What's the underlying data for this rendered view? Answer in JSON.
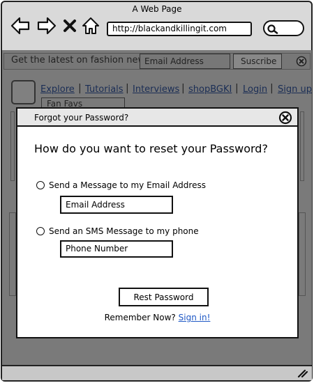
{
  "window": {
    "title": "A Web Page",
    "url": "http://blackandkillingit.com"
  },
  "newsbar": {
    "text": "Get the latest on fashion news.",
    "email_placeholder": "Email Address",
    "subscribe_label": "Suscribe"
  },
  "nav": {
    "items": [
      "Explore",
      "Tutorials",
      "Interviews",
      "shopBGKI",
      "Login",
      "Sign up"
    ],
    "dropdown_label": "Fan Favs"
  },
  "modal": {
    "title": "Forgot your Password?",
    "question": "How do you want to reset your Password?",
    "options": [
      {
        "label": "Send a Message to my Email Address",
        "placeholder": "Email Address"
      },
      {
        "label": "Send an SMS Message to my phone",
        "placeholder": "Phone Number"
      }
    ],
    "reset_label": "Rest Password",
    "remember_text": "Remember Now?",
    "signin_label": "Sign in!"
  },
  "icons": [
    "back-arrow-icon",
    "forward-arrow-icon",
    "stop-icon",
    "home-icon",
    "search-icon",
    "close-icon",
    "resize-icon"
  ],
  "colors": {
    "link": "#1d57c5",
    "overlay": "#7a7a7a"
  }
}
